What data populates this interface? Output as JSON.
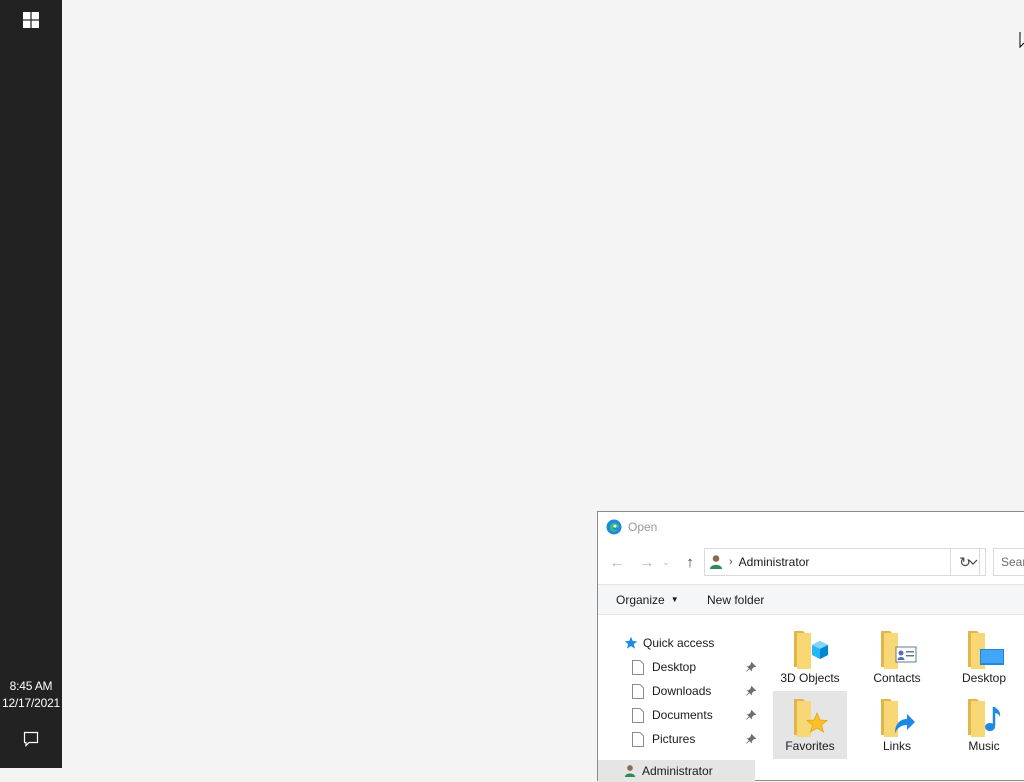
{
  "taskbar": {
    "time": "8:45 AM",
    "date": "12/17/2021"
  },
  "dialog": {
    "title": "Open",
    "address": {
      "crumb": "Administrator"
    },
    "search_placeholder": "Search Administrator",
    "commands": {
      "organize": "Organize",
      "new_folder": "New folder"
    },
    "nav_pane": {
      "quick_access": "Quick access",
      "items": [
        {
          "label": "Desktop"
        },
        {
          "label": "Downloads"
        },
        {
          "label": "Documents"
        },
        {
          "label": "Pictures"
        }
      ],
      "partial_item": "Administrator"
    },
    "folders": [
      {
        "label": "3D Objects",
        "icon": "3d-objects-folder-icon"
      },
      {
        "label": "Contacts",
        "icon": "contacts-folder-icon"
      },
      {
        "label": "Desktop",
        "icon": "desktop-folder-icon"
      },
      {
        "label": "Favorites",
        "icon": "favorites-folder-icon"
      },
      {
        "label": "Links",
        "icon": "links-folder-icon"
      },
      {
        "label": "Music",
        "icon": "music-folder-icon"
      }
    ],
    "selected_folder": "Favorites"
  },
  "colors": {
    "taskbar": "#222222",
    "desktop": "#f4f4f4",
    "folder": "#f8d775",
    "selection": "#e5e5e5",
    "accent": "#1e88e5"
  }
}
